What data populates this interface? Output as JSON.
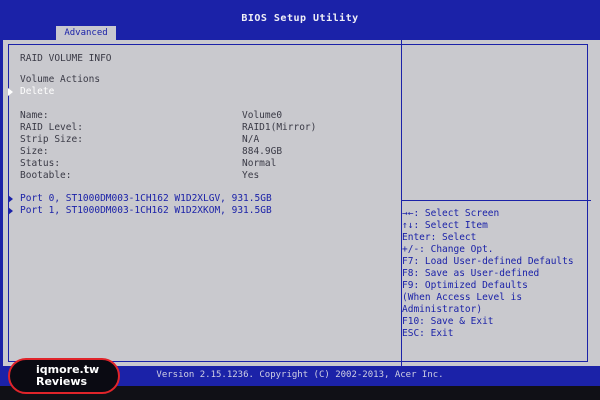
{
  "header": {
    "title": "BIOS Setup Utility",
    "tab_label": "Advanced"
  },
  "left": {
    "section_title": "RAID VOLUME INFO",
    "volume_actions_label": "Volume Actions",
    "delete_label": "Delete",
    "fields": [
      {
        "label": "Name:",
        "value": "Volume0"
      },
      {
        "label": "RAID Level:",
        "value": "RAID1(Mirror)"
      },
      {
        "label": "Strip Size:",
        "value": "N/A"
      },
      {
        "label": "Size:",
        "value": "884.9GB"
      },
      {
        "label": "Status:",
        "value": "Normal"
      },
      {
        "label": "Bootable:",
        "value": "Yes"
      }
    ],
    "ports": [
      {
        "label": "Port 0, ST1000DM003-1CH162 W1D2XLGV, 931.5GB"
      },
      {
        "label": "Port 1, ST1000DM003-1CH162 W1D2XKOM, 931.5GB"
      }
    ]
  },
  "help": [
    "→←: Select Screen",
    "↑↓: Select Item",
    "Enter: Select",
    "+/-: Change Opt.",
    "F7: Load User-defined Defaults",
    "F8: Save as User-defined",
    "F9: Optimized Defaults",
    "(When Access Level is",
    "Administrator)",
    "F10: Save & Exit",
    "ESC: Exit"
  ],
  "footer": {
    "text": "Version 2.15.1236. Copyright (C) 2002-2013, Acer Inc."
  },
  "watermark": {
    "line1": "iqmore.tw",
    "line2": "Reviews"
  },
  "colors": {
    "bios_blue": "#1b22a8",
    "panel_gray": "#c9c9ce",
    "highlight_white": "#ffffff",
    "watermark_red": "#e0242a"
  }
}
